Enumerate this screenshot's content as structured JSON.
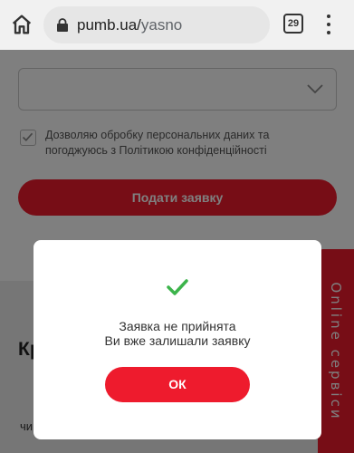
{
  "browser": {
    "url_host": "pumb.ua/",
    "url_path": "yasno",
    "tab_count": "29",
    "icons": {
      "home": "home-icon",
      "lock": "lock-icon",
      "menu": "kebab-menu-icon"
    }
  },
  "form": {
    "select_value": "",
    "consent_text": "Дозволяю обробку персональних даних та погоджуюсь з Політикою конфіденційності",
    "consent_checked": true,
    "submit_label": "Подати заявку"
  },
  "promo": {
    "title": "Кр ди",
    "text": "чи"
  },
  "side_tab": {
    "label": "Online сервіси"
  },
  "modal": {
    "line1": "Заявка не прийнята",
    "line2": "Ви вже залишали заявку",
    "ok_label": "ОК",
    "icon": "checkmark-icon"
  },
  "colors": {
    "accent": "#ee1b2d",
    "success": "#3cb44b",
    "overlay": "rgba(0,0,0,0.5)"
  }
}
